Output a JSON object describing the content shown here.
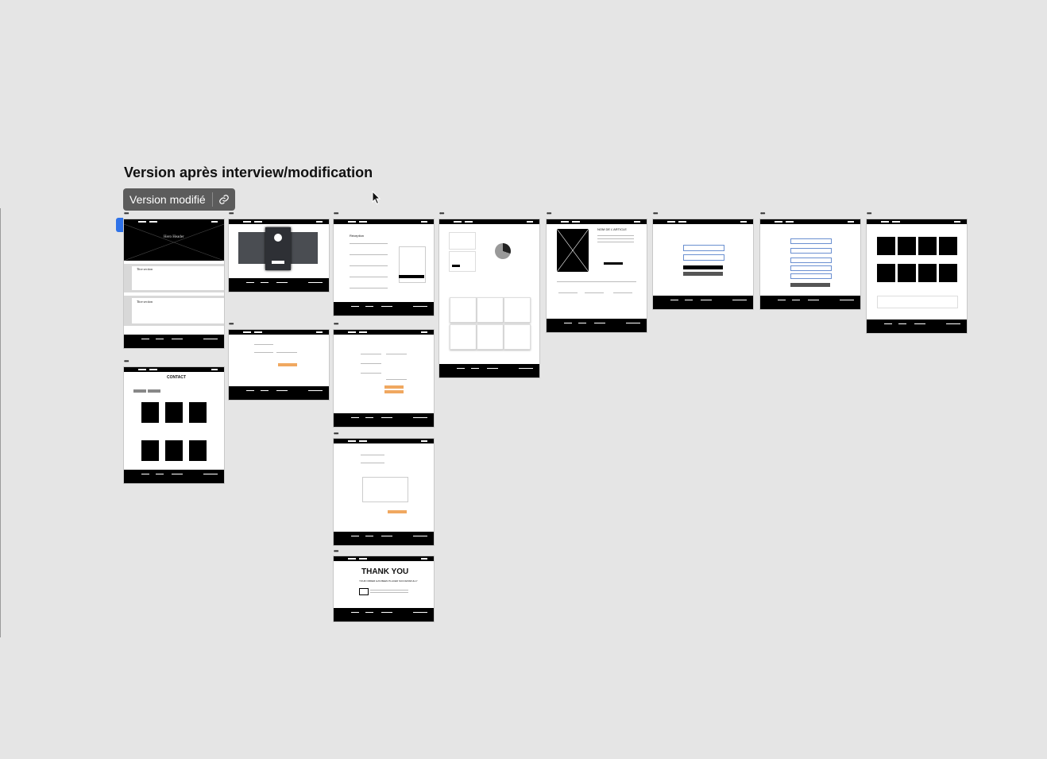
{
  "canvas": {
    "section_title": "Version après interview/modification",
    "version_label": "Version modifié"
  },
  "icons": {
    "link": "link-icon",
    "cursor": "mouse-cursor-icon",
    "frame_menu": "more-dots-icon"
  },
  "frames": {
    "hero_title": "Hero Header",
    "section_heading": "Titre section",
    "form_heading": "Réception",
    "product_title": "NOM DE L'ARTICLE",
    "contact_title": "CONTACT",
    "thank_you_title": "THANK YOU",
    "thank_you_subtitle": "YOUR ORDER HAS BEEN PLACED SUCCESSFULLY"
  },
  "colors": {
    "canvas": "#e5e5e5",
    "chip": "#5c5c5c",
    "selection": "#2f72e8",
    "accent_orange": "#f0a860"
  }
}
